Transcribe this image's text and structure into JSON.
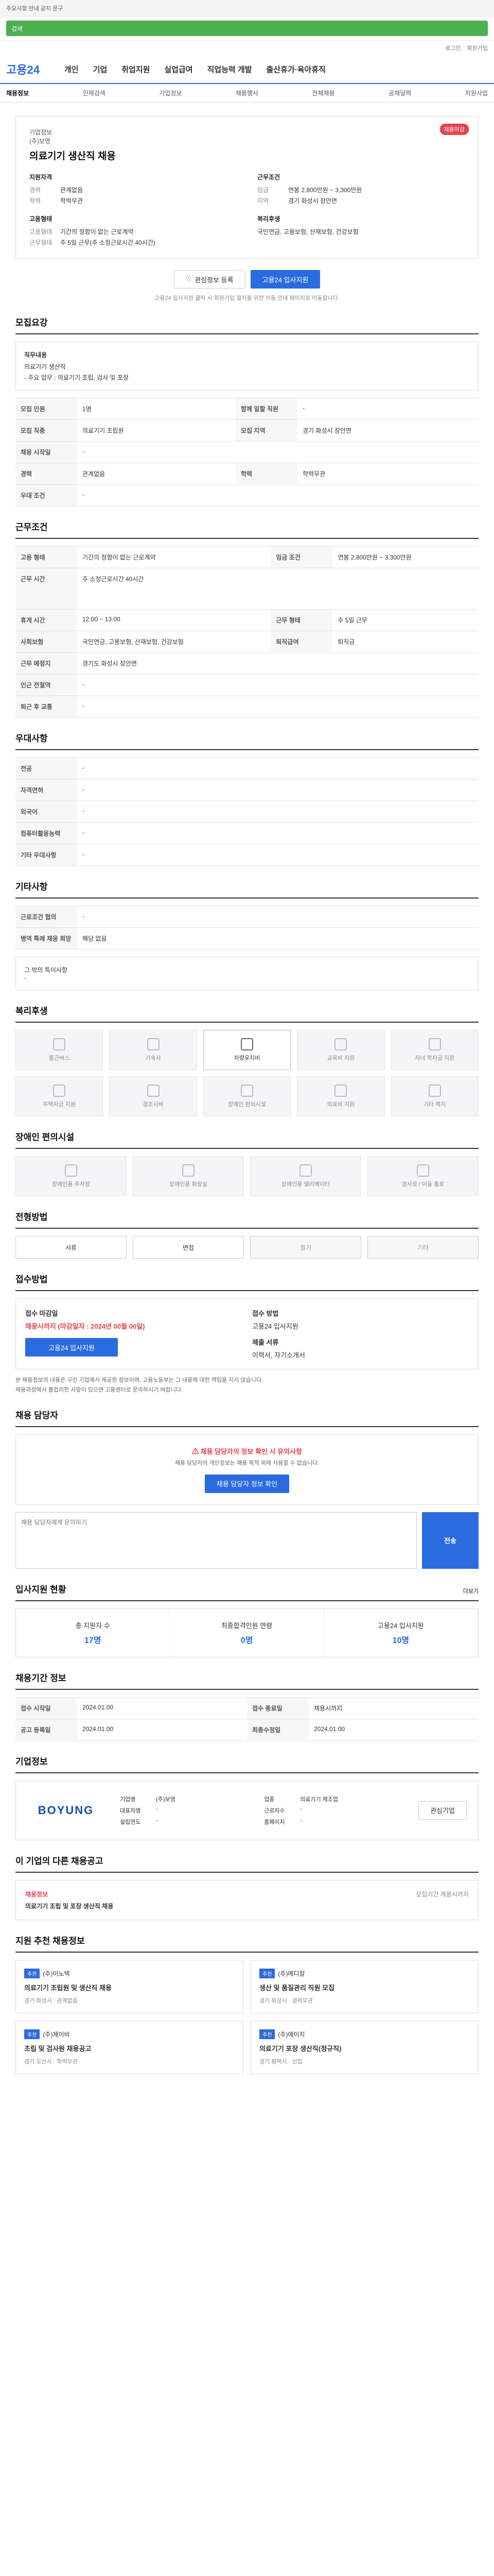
{
  "topbar": {
    "notice": "주요사항 안내 공지 문구"
  },
  "search": {
    "placeholder": "검색"
  },
  "util": [
    "로그인",
    "회원가입"
  ],
  "gnb": {
    "logo": "고용24",
    "items": [
      "개인",
      "기업",
      "취업지원",
      "실업급여",
      "직업능력 개발",
      "출산휴가·육아휴직"
    ]
  },
  "subnav": [
    "채용정보",
    "인재검색",
    "기업정보",
    "채용행사",
    "전체채용",
    "공채달력",
    "지원사업"
  ],
  "main": {
    "title": "채용정보",
    "badge": "채용마감",
    "company_label": "기업정보",
    "company": "(주)보영",
    "job_title": "의료기기 생산직 채용",
    "left_label": "지원자격",
    "right_label": "근무조건",
    "left": [
      {
        "k": "경력",
        "v": "관계없음"
      },
      {
        "k": "학력",
        "v": "학력무관"
      }
    ],
    "right": [
      {
        "k": "임금",
        "v": "연봉 2,800만원 ~ 3,300만원"
      },
      {
        "k": "지역",
        "v": "경기 화성시 장안면"
      }
    ],
    "left2_label": "고용형태",
    "left2": [
      {
        "k": "고용형태",
        "v": "기간의 정함이 없는 근로계약"
      },
      {
        "k": "근무형태",
        "v": "주 5일 근무(주 소정근로시간 40시간)"
      }
    ],
    "right2_label": "복리후생",
    "right2": [
      {
        "k": "",
        "v": "국민연금, 고용보험, 산재보험, 건강보험"
      }
    ],
    "scrap": "관심정보 등록",
    "apply": "고용24 입사지원",
    "note": "고용24 입사지원 클릭 시 회원가입 절차를 위한 이동 안내 페이지로 이동합니다."
  },
  "duty": {
    "title": "모집요강",
    "label": "직무내용",
    "items": [
      "의료기기 생산직",
      "- 주요 업무 : 의료기기 조립, 검사 및 포장"
    ],
    "rows": [
      [
        "모집 인원",
        "1명",
        "함께 일할 직원",
        "-"
      ],
      [
        "모집 직종",
        "의료기기 조립원",
        "모집 지역",
        "경기 화성시 장안면"
      ],
      [
        "채용 시작일",
        "-",
        "",
        ""
      ],
      [
        "경력",
        "관계없음",
        "학력",
        "학력무관"
      ],
      [
        "우대 조건",
        "-",
        "",
        ""
      ]
    ]
  },
  "cond": {
    "title": "근무조건",
    "rows": [
      [
        "고용 형태",
        "기간의 정함이 없는 근로계약",
        "임금 조건",
        "연봉 2,800만원 ~ 3,300만원"
      ],
      [
        "근무 시간",
        "주 소정근로시간 40시간",
        "",
        ""
      ],
      [
        "휴게 시간",
        "12:00 ~ 13:00",
        "근무 형태",
        "주 5일 근무"
      ],
      [
        "사회보험",
        "국민연금, 고용보험, 산재보험, 건강보험",
        "퇴직급여",
        "퇴직금"
      ],
      [
        "근무 예정지",
        "경기도 화성시 장안면",
        "",
        ""
      ],
      [
        "인근 전철역",
        "-",
        "",
        ""
      ],
      [
        "퇴근 후 교통",
        "-",
        "",
        ""
      ]
    ]
  },
  "pref": {
    "title": "우대사항",
    "rows": [
      [
        "전공",
        "-"
      ],
      [
        "자격면허",
        "-"
      ],
      [
        "외국어",
        "-"
      ],
      [
        "컴퓨터활용능력",
        "-"
      ],
      [
        "기타 우대사항",
        "-"
      ]
    ]
  },
  "etc": {
    "title": "기타사항",
    "rows": [
      [
        "근로조건 협의",
        "-"
      ],
      [
        "병역 특례 채용 희망",
        "해당 없음"
      ]
    ]
  },
  "etc_box": "그 밖의 특이사항\n-",
  "welfare": {
    "title": "복리후생",
    "items": [
      "통근버스",
      "기숙사",
      "차량유지비",
      "교육비 지원",
      "자녀 학자금 지원",
      "주택자금 지원",
      "경조사비",
      "장애인 편의시설",
      "의료비 지원",
      "기타 복지"
    ],
    "on": [
      2
    ]
  },
  "facil": {
    "title": "장애인 편의시설",
    "items": [
      "장애인용 주차장",
      "장애인용 화장실",
      "장애인용 엘리베이터",
      "경사로 / 이동 통로"
    ]
  },
  "process": {
    "title": "전형방법",
    "items": [
      "서류",
      "면접",
      "필기",
      "기타"
    ],
    "on": [
      0,
      1
    ]
  },
  "apply_sec": {
    "title": "접수방법",
    "items": [
      [
        "접수 마감일",
        "채용시까지 (마감일자 : 2024년 00월 00일)"
      ],
      [
        "접수 방법",
        "고용24 입사지원"
      ],
      [
        "제출 서류",
        "이력서, 자기소개서"
      ]
    ]
  },
  "notes": [
    "본 채용정보의 내용은 구인 기업에서 제공한 정보이며, 고용노동부는 그 내용에 대한 책임을 지지 않습니다.",
    "채용과정에서 불합리한 사항이 있으면 고용센터로 문의하시기 바랍니다."
  ],
  "contact": {
    "title": "채용 담당자",
    "warn": "채용 담당자의 정보 확인 시 유의사항",
    "msg": "채용 담당자의 개인정보는 채용 목적 외에 사용할 수 없습니다.",
    "btn": "채용 담당자 정보 확인",
    "placeholder": "채용 담당자에게 문의하기",
    "send": "전송"
  },
  "stats": {
    "title": "입사지원 현황",
    "items": [
      [
        "총 지원자 수",
        "17명"
      ],
      [
        "최종합격인원 연령",
        "0명"
      ],
      [
        "고용24 입사지원",
        "10명"
      ]
    ],
    "more": "더보기"
  },
  "period": {
    "title": "채용기간 정보",
    "rows": [
      [
        "접수 시작일",
        "2024.01.00",
        "접수 종료일",
        "채용시까지"
      ],
      [
        "공고 등록일",
        "2024.01.00",
        "최종수정일",
        "2024.01.00"
      ]
    ]
  },
  "company": {
    "title": "기업정보",
    "logo": "BOYUNG",
    "rows": [
      [
        "기업명",
        "(주)보영",
        "업종",
        "의료기기 제조업"
      ],
      [
        "대표자명",
        "-",
        "근로자수",
        "-"
      ],
      [
        "설립연도",
        "-",
        "홈페이지",
        "-"
      ]
    ],
    "btn": "관심기업"
  },
  "similar": {
    "title": "이 기업의 다른 채용공고",
    "label": "채용정보",
    "text": "의료기기 조립 및 포장 생산직 채용",
    "date": "모집기간 채용시까지"
  },
  "recent": {
    "title": "지원 추천 채용정보",
    "cards": [
      {
        "tag": "추천",
        "co": "(주)이노텍",
        "t": "의료기기 조립원 및 생산직 채용",
        "m": "경기 화성시 · 관계없음"
      },
      {
        "tag": "추천",
        "co": "(주)메디칼",
        "t": "생산 및 품질관리 직원 모집",
        "m": "경기 화성시 · 경력무관"
      },
      {
        "tag": "추천",
        "co": "(주)제이비",
        "t": "조립 및 검사원 채용공고",
        "m": "경기 오산시 · 학력무관"
      },
      {
        "tag": "추천",
        "co": "(주)에이치",
        "t": "의료기기 포장 생산직(정규직)",
        "m": "경기 평택시 · 신입"
      }
    ]
  }
}
